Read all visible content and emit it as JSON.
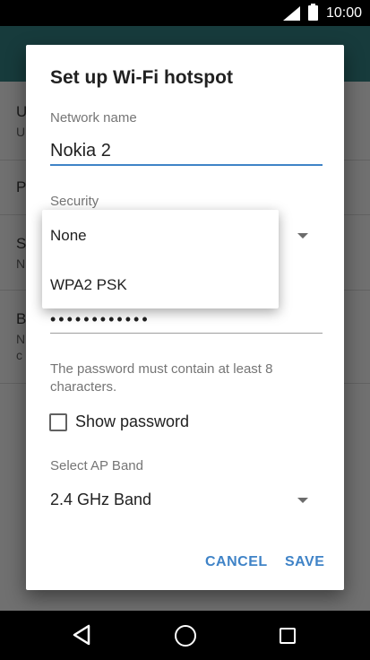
{
  "status_bar": {
    "time": "10:00",
    "icons": [
      "signal-icon",
      "battery-icon"
    ]
  },
  "background": {
    "rows": [
      {
        "letter": "U",
        "sub": "U"
      },
      {
        "letter": "P",
        "sub": ""
      },
      {
        "letter": "S",
        "sub": "N"
      },
      {
        "letter": "B",
        "sub": "N",
        "sub2": "c"
      }
    ]
  },
  "dialog": {
    "title": "Set up Wi-Fi hotspot",
    "network_name_label": "Network name",
    "network_name_value": "Nokia 2",
    "security_label": "Security",
    "password_dots": "••••••••••••",
    "password_hint": "The password must contain at least 8 characters.",
    "show_password_label": "Show password",
    "show_password_checked": false,
    "ap_band_label": "Select AP Band",
    "ap_band_value": "2.4 GHz Band",
    "cancel_label": "CANCEL",
    "save_label": "SAVE"
  },
  "security_dropdown": {
    "options": [
      "None",
      "WPA2 PSK"
    ]
  },
  "colors": {
    "accent": "#3f83c7",
    "toolbar": "#173b3c"
  },
  "nav_bar": {
    "icons": [
      "back-icon",
      "home-icon",
      "recents-icon"
    ]
  }
}
